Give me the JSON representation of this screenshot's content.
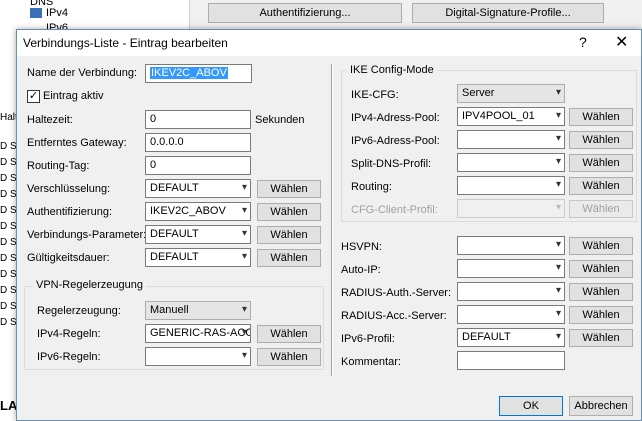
{
  "background": {
    "tree_items": [
      "DNS",
      "IPv4",
      "IPv6"
    ],
    "row_labels": [
      "D Se",
      "D Se",
      "D Se",
      "D Se",
      "D Se",
      "D Se",
      "D Se",
      "D Se",
      "D Se",
      "D Se",
      "D Se",
      "D Se"
    ],
    "side_label": "Halte",
    "side_bottom": "LA",
    "auth_button": "Authentifizierung...",
    "sig_button": "Digital-Signature-Profile..."
  },
  "dialog": {
    "title": "Verbindungs-Liste - Eintrag bearbeiten",
    "help": "?",
    "close": "✕"
  },
  "left": {
    "name_label": "Name der Verbindung:",
    "name_value": "IKEV2C_ABOV",
    "active_label": "Eintrag aktiv",
    "active_check": "✓",
    "hold_label": "Haltezeit:",
    "hold_value": "0",
    "hold_unit": "Sekunden",
    "gateway_label": "Entferntes Gateway:",
    "gateway_value": "0.0.0.0",
    "routing_tag_label": "Routing-Tag:",
    "routing_tag_value": "0",
    "encryption_label": "Verschlüsselung:",
    "encryption_value": "DEFAULT",
    "auth_label": "Authentifizierung:",
    "auth_value": "IKEV2C_ABOV",
    "params_label": "Verbindungs-Parameter:",
    "params_value": "DEFAULT",
    "validity_label": "Gültigkeitsdauer:",
    "validity_value": "DEFAULT",
    "choose": "Wählen"
  },
  "vpn": {
    "group_title": "VPN-Regelerzeugung",
    "rule_gen_label": "Regelerzeugung:",
    "rule_gen_value": "Manuell",
    "ipv4_label": "IPv4-Regeln:",
    "ipv4_value": "GENERIC-RAS-ACC",
    "ipv6_label": "IPv6-Regeln:",
    "ipv6_value": ""
  },
  "ike": {
    "group_title": "IKE Config-Mode",
    "cfg_label": "IKE-CFG:",
    "cfg_value": "Server",
    "ipv4_pool_label": "IPv4-Adress-Pool:",
    "ipv4_pool_value": "IPV4POOL_01",
    "ipv6_pool_label": "IPv6-Adress-Pool:",
    "ipv6_pool_value": "",
    "split_dns_label": "Split-DNS-Profil:",
    "split_dns_value": "",
    "routing_label": "Routing:",
    "routing_value": "",
    "client_profile_label": "CFG-Client-Profil:",
    "client_profile_value": ""
  },
  "right": {
    "hsvpn_label": "HSVPN:",
    "autoip_label": "Auto-IP:",
    "radius_auth_label": "RADIUS-Auth.-Server:",
    "radius_acc_label": "RADIUS-Acc.-Server:",
    "ipv6_profile_label": "IPv6-Profil:",
    "ipv6_profile_value": "DEFAULT",
    "comment_label": "Kommentar:",
    "comment_value": ""
  },
  "footer": {
    "ok": "OK",
    "cancel": "Abbrechen"
  },
  "icons": {
    "dropdown": "▾"
  }
}
